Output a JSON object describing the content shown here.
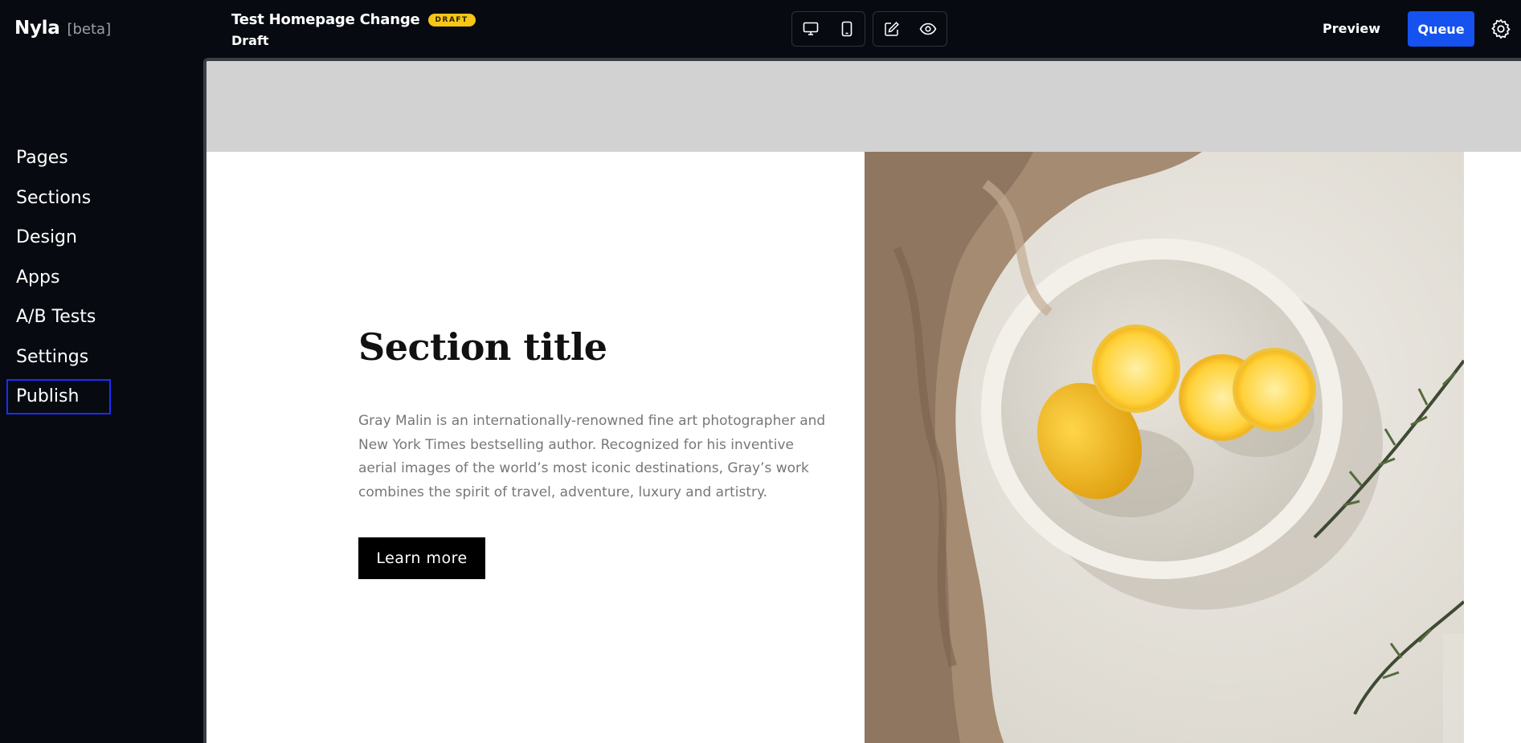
{
  "sidebar": {
    "brand": {
      "name": "Nyla",
      "tag": "[beta]"
    },
    "items": [
      {
        "label": "Pages"
      },
      {
        "label": "Sections"
      },
      {
        "label": "Design"
      },
      {
        "label": "Apps"
      },
      {
        "label": "A/B Tests"
      },
      {
        "label": "Settings"
      },
      {
        "label": "Publish",
        "active": true
      }
    ]
  },
  "header": {
    "title": "Test Homepage Change",
    "badge": "DRAFT",
    "status": "Draft",
    "toolbar": {
      "device_icons": [
        "desktop-icon",
        "mobile-icon"
      ],
      "mode_icons": [
        "edit-icon",
        "eye-icon"
      ]
    },
    "preview_label": "Preview",
    "queue_label": "Queue",
    "settings_icon": "gear-icon"
  },
  "canvas": {
    "section": {
      "title": "Section title",
      "body": "Gray Malin is an internationally-renowned fine art photographer and New York Times bestselling author. Recognized for his inventive aerial images of the world’s most iconic destinations, Gray’s work combines the spirit of travel, adventure, luxury and artistry.",
      "button_label": "Learn more"
    }
  },
  "colors": {
    "app_background": "#070b11",
    "accent_blue": "#1552f0",
    "badge_yellow": "#f5c518",
    "active_outline": "#1f2bff",
    "banner_gray": "#d2d2d3"
  }
}
